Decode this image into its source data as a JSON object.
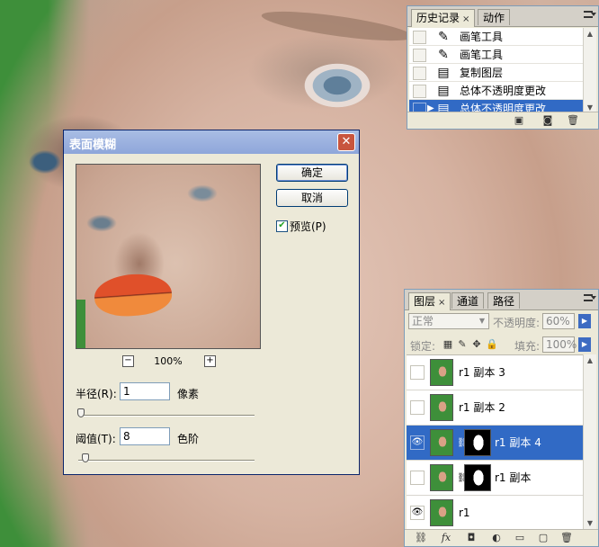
{
  "history": {
    "tabs": [
      {
        "label": "历史记录",
        "close": "×"
      },
      {
        "label": "动作"
      }
    ],
    "items": [
      {
        "label": "画笔工具",
        "icon": "brush-icon",
        "glyph": "✎"
      },
      {
        "label": "画笔工具",
        "icon": "brush-icon",
        "glyph": "✎"
      },
      {
        "label": "复制图层",
        "icon": "document-icon",
        "glyph": "▤"
      },
      {
        "label": "总体不透明度更改",
        "icon": "document-icon",
        "glyph": "▤"
      },
      {
        "label": "总体不透明度更改",
        "icon": "document-icon",
        "glyph": "▤",
        "selected": true
      }
    ],
    "footer_icons": [
      "new-document-from-state-icon",
      "camera-icon",
      "trash-icon"
    ]
  },
  "dialog": {
    "title": "表面模糊",
    "close": "✕",
    "ok_label": "确定",
    "cancel_label": "取消",
    "preview_label": "预览(P)",
    "preview_checked": true,
    "zoom": "100%",
    "zoom_out": "−",
    "zoom_in": "+",
    "radius_label": "半径(R):",
    "radius_value": "1",
    "radius_unit": "像素",
    "threshold_label": "阈值(T):",
    "threshold_value": "8",
    "threshold_unit": "色阶"
  },
  "layers": {
    "tabs": [
      {
        "label": "图层",
        "close": "×"
      },
      {
        "label": "通道"
      },
      {
        "label": "路径"
      }
    ],
    "blend_mode": "正常",
    "opacity_label": "不透明度:",
    "opacity_value": "60%",
    "lock_label": "锁定:",
    "fill_label": "填充:",
    "fill_value": "100%",
    "items": [
      {
        "name": "r1 副本 3",
        "visible": false,
        "mask": false
      },
      {
        "name": "r1 副本 2",
        "visible": false,
        "mask": false
      },
      {
        "name": "r1 副本 4",
        "visible": true,
        "mask": true,
        "selected": true
      },
      {
        "name": "r1 副本",
        "visible": false,
        "mask": true
      },
      {
        "name": "r1",
        "visible": true,
        "mask": false
      }
    ],
    "footer_icons": [
      "link-icon",
      "fx-icon",
      "add-mask-icon",
      "adjustment-layer-icon",
      "folder-icon",
      "new-layer-icon",
      "trash-icon"
    ]
  },
  "colors": {
    "selection": "#316ac5",
    "titlebar": "#8ea6da",
    "close_button": "#c8553e",
    "green_screen": "#3e8f3a"
  }
}
